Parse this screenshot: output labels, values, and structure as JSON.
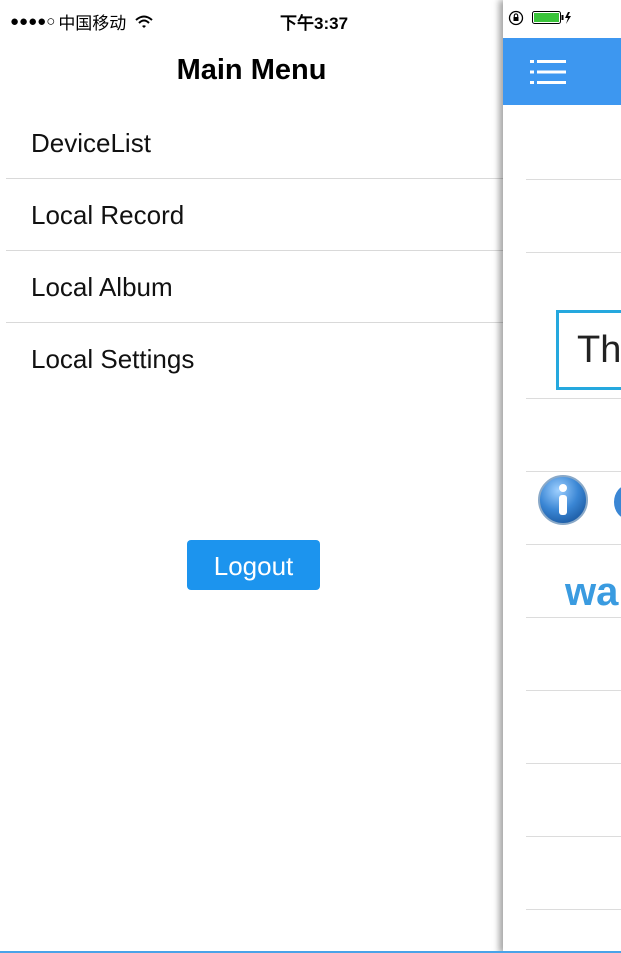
{
  "status_bar": {
    "signal": "●●●●○",
    "carrier": "中国移动",
    "time": "下午3:37"
  },
  "menu": {
    "title": "Main Menu",
    "items": [
      {
        "label": "DeviceList"
      },
      {
        "label": "Local Record"
      },
      {
        "label": "Local Album"
      },
      {
        "label": "Local Settings"
      }
    ],
    "logout_label": "Logout"
  },
  "main": {
    "textbox_text": "Th",
    "partial_label": "wa"
  },
  "colors": {
    "accent": "#1c94ee",
    "navbar": "#3d97f0",
    "textbox_border": "#25a8de",
    "info_icon": "#3a86d4"
  }
}
